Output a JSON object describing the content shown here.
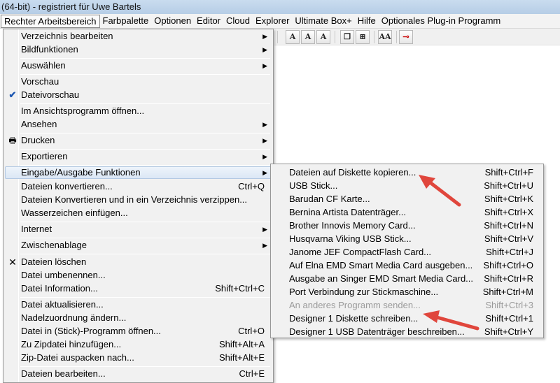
{
  "window": {
    "title": "(64-bit) - registriert für Uwe Bartels"
  },
  "menubar": {
    "items": [
      {
        "label": "Rechter Arbeitsbereich"
      },
      {
        "label": "Farbpalette"
      },
      {
        "label": "Optionen"
      },
      {
        "label": "Editor"
      },
      {
        "label": "Cloud"
      },
      {
        "label": "Explorer"
      },
      {
        "label": "Ultimate Box+"
      },
      {
        "label": "Hilfe"
      },
      {
        "label": "Optionales Plug-in Programm"
      }
    ]
  },
  "toolbar": {
    "buttons": [
      {
        "glyph": "A"
      },
      {
        "glyph": "A"
      },
      {
        "glyph": "A"
      },
      {
        "glyph": "❐"
      },
      {
        "glyph": "⊞"
      },
      {
        "glyph": "AA"
      },
      {
        "glyph": "⊸"
      }
    ]
  },
  "menu": {
    "items": [
      {
        "label": "Verzeichnis bearbeiten",
        "submenu": true
      },
      {
        "label": "Bildfunktionen",
        "submenu": true
      },
      {
        "label": "Auswählen",
        "submenu": true
      },
      {
        "label": "Vorschau"
      },
      {
        "label": "Dateivorschau",
        "checked": true
      },
      {
        "label": "Im Ansichtsprogramm öffnen..."
      },
      {
        "label": "Ansehen",
        "submenu": true
      },
      {
        "label": "Drucken",
        "submenu": true,
        "icon": "printer-icon"
      },
      {
        "label": "Exportieren",
        "submenu": true
      },
      {
        "label": "Eingabe/Ausgabe Funktionen",
        "submenu": true,
        "highlighted": true
      },
      {
        "label": "Dateien konvertieren...",
        "shortcut": "Ctrl+Q"
      },
      {
        "label": "Dateien Konvertieren und in ein Verzeichnis verzippen..."
      },
      {
        "label": "Wasserzeichen einfügen..."
      },
      {
        "label": "Internet",
        "submenu": true
      },
      {
        "label": "Zwischenablage",
        "submenu": true
      },
      {
        "label": "Dateien löschen",
        "icon": "delete-x-icon"
      },
      {
        "label": "Datei umbenennen..."
      },
      {
        "label": "Datei Information...",
        "shortcut": "Shift+Ctrl+C"
      },
      {
        "label": "Datei aktualisieren..."
      },
      {
        "label": "Nadelzuordnung ändern..."
      },
      {
        "label": "Datei in (Stick)-Programm öffnen...",
        "shortcut": "Ctrl+O"
      },
      {
        "label": "Zu Zipdatei hinzufügen...",
        "shortcut": "Shift+Alt+A"
      },
      {
        "label": "Zip-Datei auspacken nach...",
        "shortcut": "Shift+Alt+E"
      },
      {
        "label": "Dateien bearbeiten...",
        "shortcut": "Ctrl+E"
      }
    ]
  },
  "submenu": {
    "items": [
      {
        "label": "Dateien auf Diskette kopieren...",
        "shortcut": "Shift+Ctrl+F"
      },
      {
        "label": "USB Stick...",
        "shortcut": "Shift+Ctrl+U"
      },
      {
        "label": "Barudan CF Karte...",
        "shortcut": "Shift+Ctrl+K"
      },
      {
        "label": "Bernina Artista Datenträger...",
        "shortcut": "Shift+Ctrl+X"
      },
      {
        "label": "Brother Innovis Memory Card...",
        "shortcut": "Shift+Ctrl+N"
      },
      {
        "label": "Husqvarna Viking USB Stick...",
        "shortcut": "Shift+Ctrl+V"
      },
      {
        "label": "Janome JEF CompactFlash Card...",
        "shortcut": "Shift+Ctrl+J"
      },
      {
        "label": "Auf Elna EMD Smart Media Card ausgeben...",
        "shortcut": "Shift+Ctrl+O"
      },
      {
        "label": "Ausgabe an Singer EMD Smart Media Card...",
        "shortcut": "Shift+Ctrl+R"
      },
      {
        "label": "Port Verbindung zur Stickmaschine...",
        "shortcut": "Shift+Ctrl+M"
      },
      {
        "label": "An anderes Programm senden...",
        "shortcut": "Shift+Ctrl+3",
        "disabled": true
      },
      {
        "label": "Designer 1 Diskette schreiben...",
        "shortcut": "Shift+Ctrl+1"
      },
      {
        "label": "Designer 1 USB Datenträger beschreiben...",
        "shortcut": "Shift+Ctrl+Y"
      }
    ]
  },
  "colors": {
    "arrow": "#e0463c",
    "highlight": "#dbe7f5",
    "menu_bg": "#f1f1f1"
  }
}
